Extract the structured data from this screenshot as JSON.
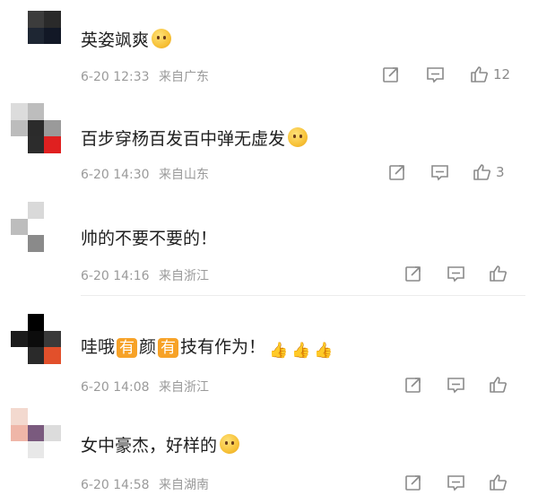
{
  "comments": [
    {
      "text": "英姿飒爽",
      "emoji": "blushing-face-with-hands",
      "date": "6-20 12:33",
      "location": "来自广东",
      "likes": "12",
      "avatar_colors": [
        "#ffffff",
        "#3c3c3c",
        "#2a2a2a",
        "#ffffff",
        "#1e2633",
        "#121826",
        "#ffffff",
        "#ffffff",
        "#ffffff"
      ]
    },
    {
      "text": "百步穿杨百发百中弹无虚发",
      "emoji": "crying-emoji",
      "date": "6-20 14:30",
      "location": "来自山东",
      "likes": "3",
      "avatar_colors": [
        "#dcdcdc",
        "#bdbdbd",
        "#ffffff",
        "#bcbcbc",
        "#2b2b2b",
        "#9a9a9a",
        "#ffffff",
        "#2c2c2c",
        "#e02020"
      ]
    },
    {
      "text": "帅的不要不要的！",
      "emoji": "",
      "date": "6-20 14:16",
      "location": "来自浙江",
      "likes": "",
      "avatar_colors": [
        "#ffffff",
        "#d9d9d9",
        "#ffffff",
        "#bdbdbd",
        "#ffffff",
        "#ffffff",
        "#ffffff",
        "#8a8a8a",
        "#ffffff"
      ]
    },
    {
      "text_prefix": "哇哦",
      "tag1": "有",
      "text_mid": "颜",
      "tag2": "有",
      "text_suffix": "技有作为！",
      "emoji": "thumbs-up",
      "date": "6-20 14:08",
      "location": "来自浙江",
      "likes": "",
      "avatar_colors": [
        "#ffffff",
        "#000000",
        "#ffffff",
        "#1b1b1b",
        "#0c0c0c",
        "#3a3a3a",
        "#ffffff",
        "#2a2a2a",
        "#e2502b"
      ]
    },
    {
      "text": "女中豪杰，好样的",
      "emoji": "surprised-emoji",
      "date": "6-20 14:58",
      "location": "来自湖南",
      "likes": "",
      "avatar_colors": [
        "#f3d9cf",
        "#ffffff",
        "#ffffff",
        "#efb6a8",
        "#7a5a7e",
        "#dcdcdc",
        "#ffffff",
        "#e8e8e8",
        "#ffffff"
      ]
    }
  ]
}
